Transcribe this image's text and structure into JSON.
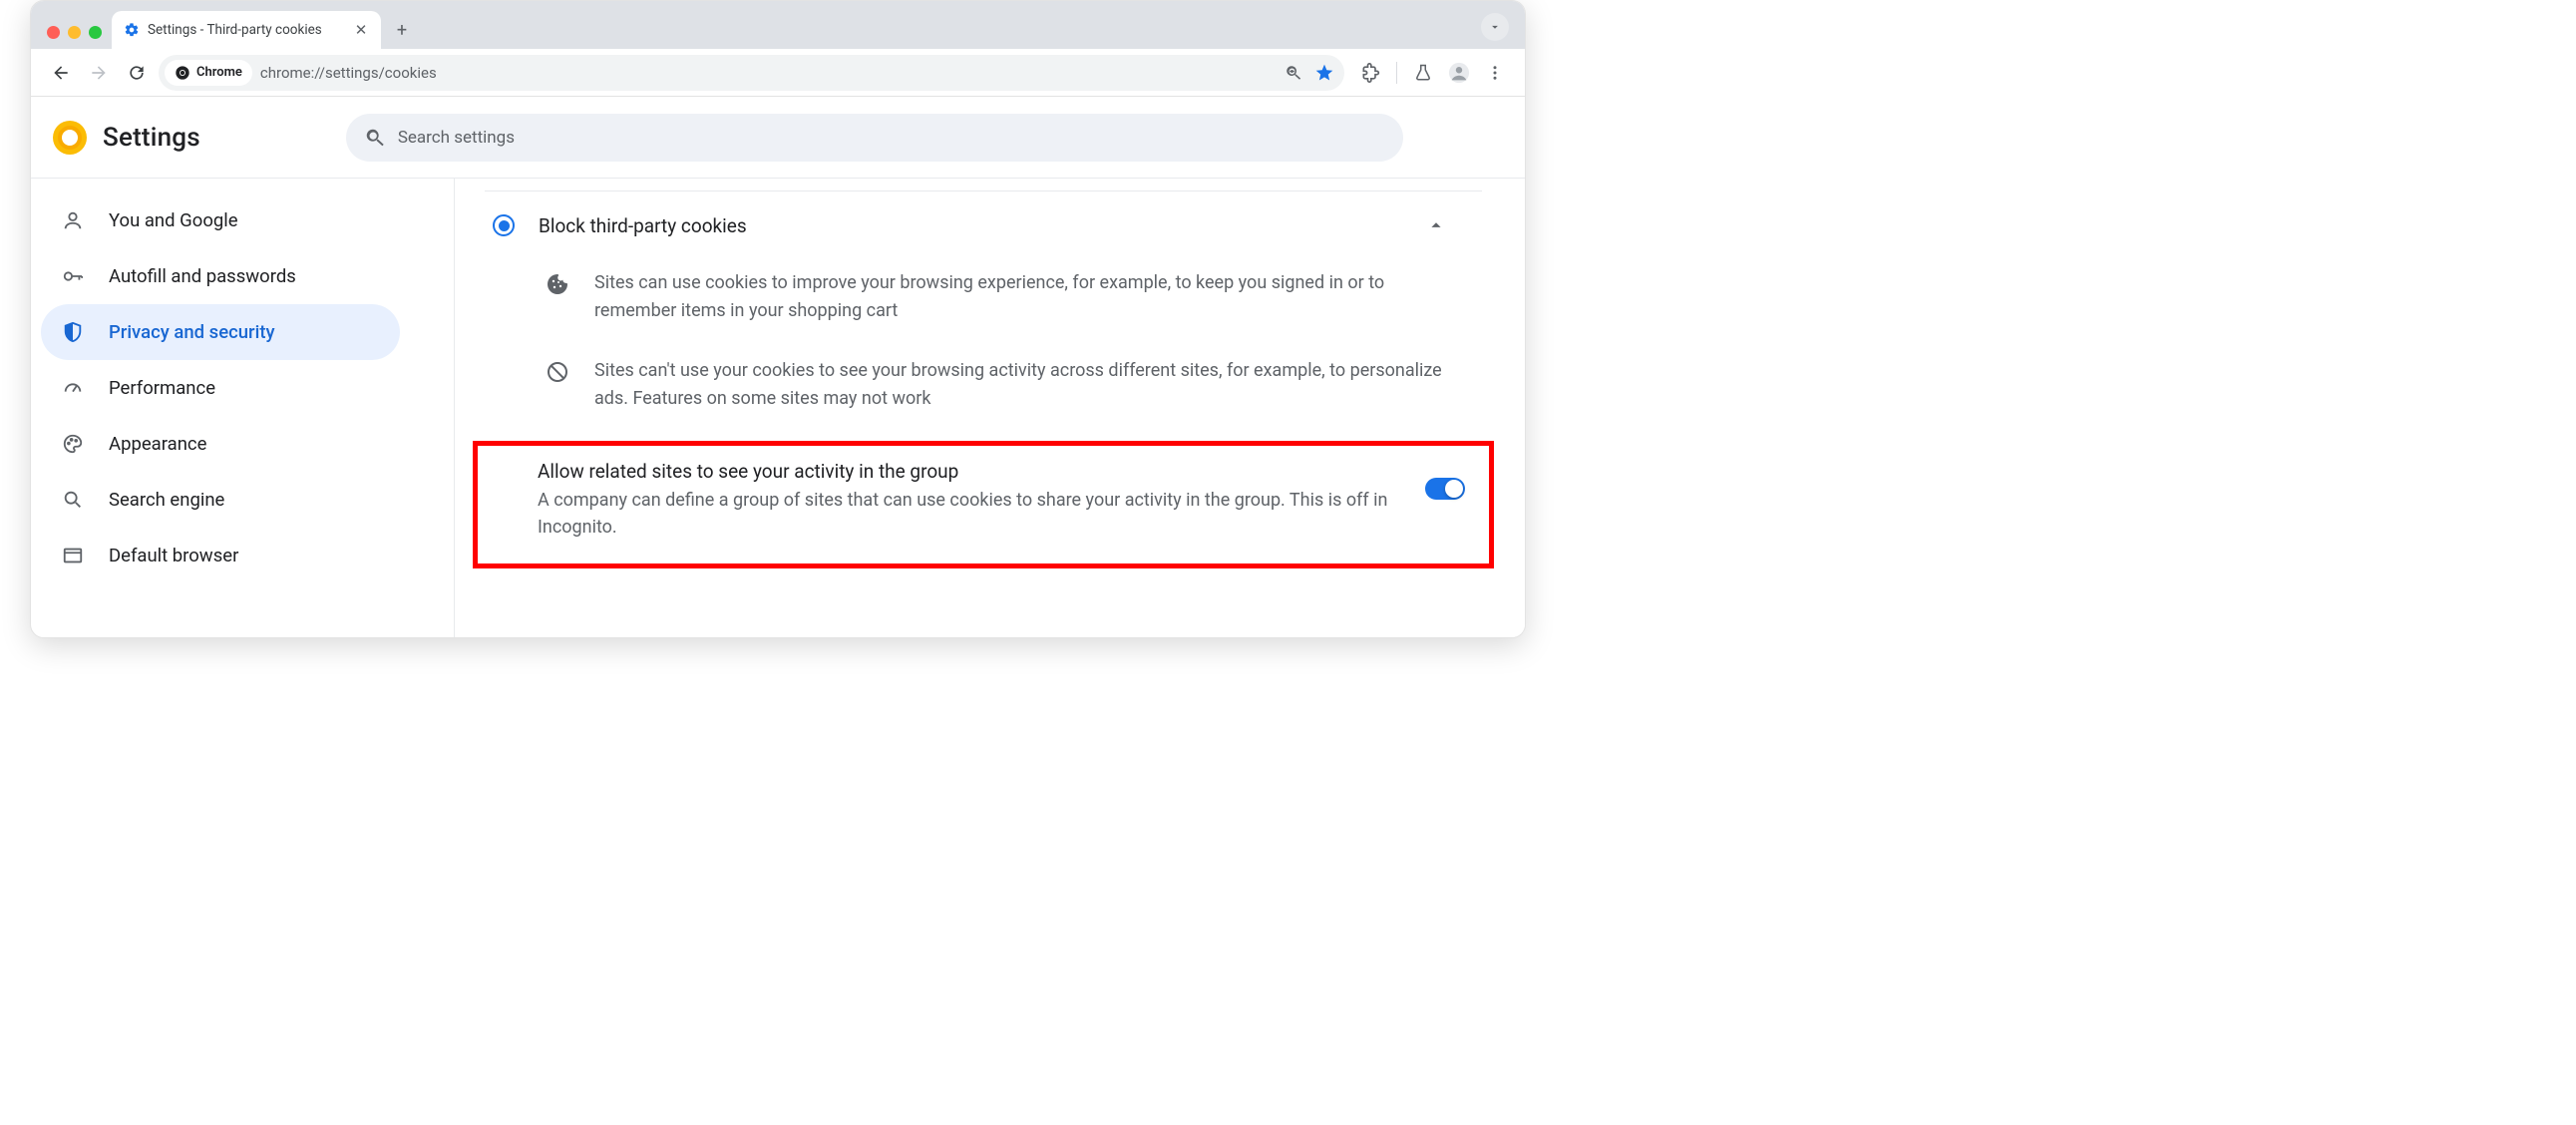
{
  "tab": {
    "title": "Settings - Third-party cookies"
  },
  "omnibox": {
    "chip": "Chrome",
    "url": "chrome://settings/cookies"
  },
  "header": {
    "title": "Settings",
    "search_placeholder": "Search settings"
  },
  "sidebar": {
    "items": [
      {
        "label": "You and Google"
      },
      {
        "label": "Autofill and passwords"
      },
      {
        "label": "Privacy and security"
      },
      {
        "label": "Performance"
      },
      {
        "label": "Appearance"
      },
      {
        "label": "Search engine"
      },
      {
        "label": "Default browser"
      }
    ],
    "active_index": 2
  },
  "main": {
    "radio_label": "Block third-party cookies",
    "detail1": "Sites can use cookies to improve your browsing experience, for example, to keep you signed in or to remember items in your shopping cart",
    "detail2": "Sites can't use your cookies to see your browsing activity across different sites, for example, to personalize ads. Features on some sites may not work",
    "toggle_title": "Allow related sites to see your activity in the group",
    "toggle_desc": "A company can define a group of sites that can use cookies to share your activity in the group. This is off in Incognito."
  }
}
